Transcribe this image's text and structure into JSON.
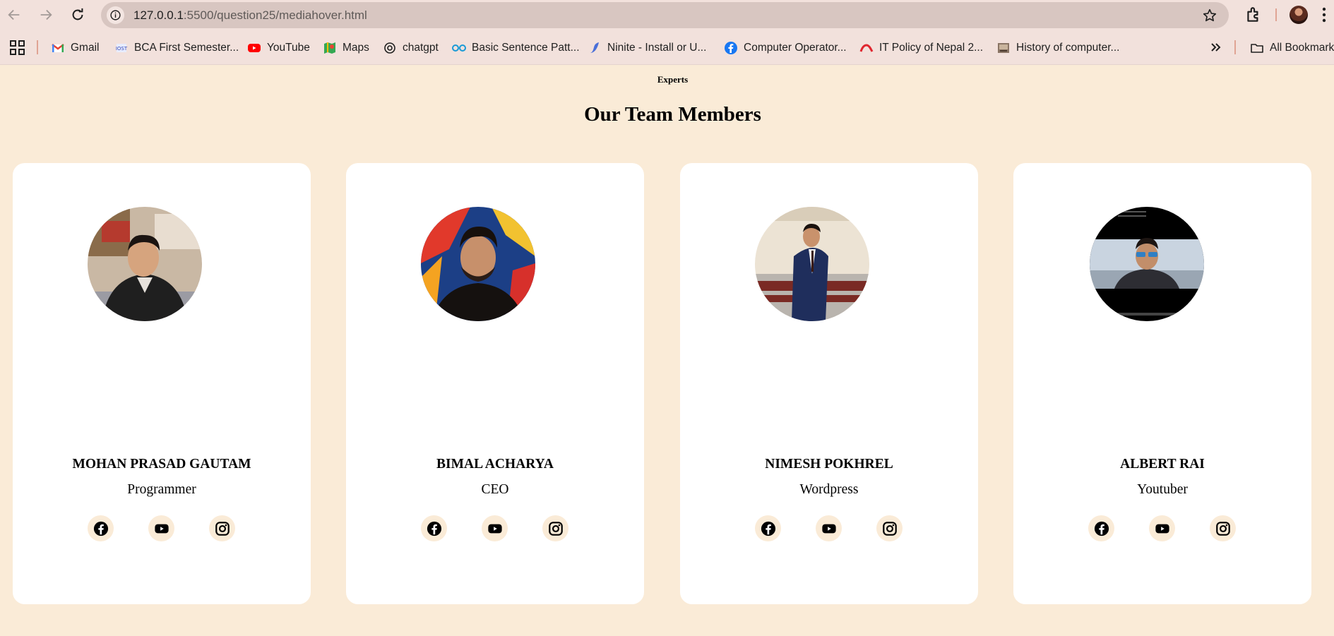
{
  "browser": {
    "url_host": "127.0.0.1",
    "url_rest": ":5500/question25/mediahover.html",
    "bookmarks": [
      {
        "label": "Gmail",
        "icon": "gmail-icon"
      },
      {
        "label": "BCA First Semester...",
        "icon": "bca-icon"
      },
      {
        "label": "YouTube",
        "icon": "youtube-icon"
      },
      {
        "label": "Maps",
        "icon": "maps-icon"
      },
      {
        "label": "chatgpt",
        "icon": "chatgpt-icon"
      },
      {
        "label": "Basic Sentence Patt...",
        "icon": "link-icon"
      },
      {
        "label": "Ninite - Install or U...",
        "icon": "ninite-icon"
      },
      {
        "label": "Computer Operator...",
        "icon": "facebook-icon"
      },
      {
        "label": "IT Policy of Nepal 2...",
        "icon": "it-policy-icon"
      },
      {
        "label": "History of computer...",
        "icon": "history-icon"
      }
    ],
    "all_bookmarks_label": "All Bookmarks"
  },
  "page": {
    "subtitle": "Experts",
    "title": "Our Team Members"
  },
  "members": [
    {
      "name": "MOHAN PRASAD GAUTAM",
      "role": "Programmer"
    },
    {
      "name": "BIMAL ACHARYA",
      "role": "CEO"
    },
    {
      "name": "NIMESH POKHREL",
      "role": "Wordpress"
    },
    {
      "name": "ALBERT RAI",
      "role": "Youtuber"
    }
  ],
  "colors": {
    "page_background": "#faebd7",
    "card_background": "#ffffff",
    "social_background": "#faebd7",
    "chrome_background": "#f2e1dc"
  }
}
